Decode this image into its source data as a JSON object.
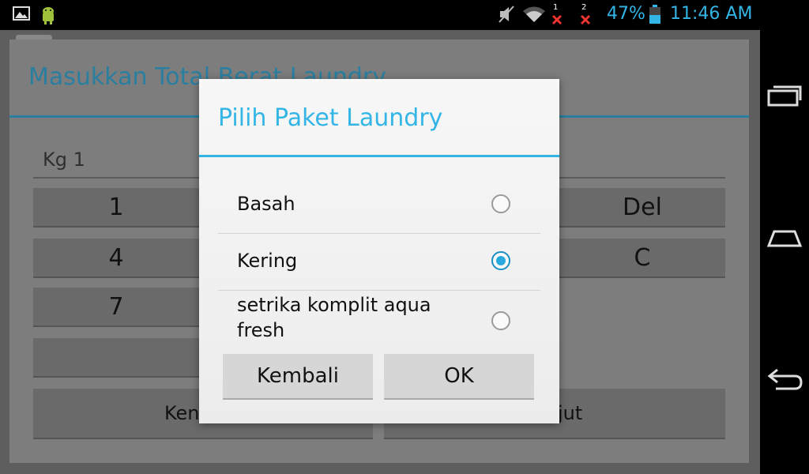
{
  "status_bar": {
    "notif_1_count": "1",
    "notif_2_count": "2",
    "battery": "47%",
    "time": "11:46 AM"
  },
  "activity": {
    "title": "Masukkan Total Berat Laundry",
    "input_value": "Kg 1",
    "keypad": {
      "key_1": "1",
      "key_4": "4",
      "key_7": "7",
      "key_del": "Del",
      "key_c": "C",
      "button_kembali_partial": "Ken",
      "button_lanjut_partial": "jut"
    }
  },
  "dialog": {
    "title": "Pilih Paket Laundry",
    "options": [
      {
        "label": "Basah",
        "selected": false
      },
      {
        "label": "Kering",
        "selected": true
      },
      {
        "label": "setrika komplit aqua fresh",
        "selected": false
      }
    ],
    "cancel_label": "Kembali",
    "ok_label": "OK"
  },
  "colors": {
    "accent": "#33b5e5",
    "background_dim": "#7d7d7d"
  }
}
